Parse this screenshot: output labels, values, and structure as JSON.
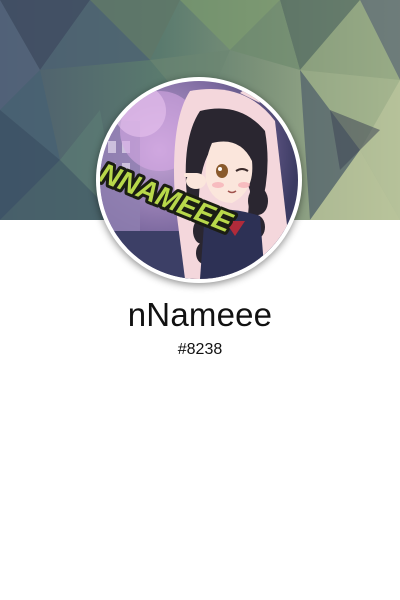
{
  "profile": {
    "username": "nNameee",
    "discriminator": "#8238",
    "avatar_text": "NNAMEEE",
    "avatar_icon": "anime-avatar-icon",
    "banner_icon": "low-poly-banner"
  },
  "colors": {
    "background": "#ffffff",
    "text": "#111111",
    "banner_left": "#4d5c6e",
    "banner_right": "#adbb96",
    "avatar_border": "#ffffff",
    "logo_fill": "#b8d84a"
  }
}
